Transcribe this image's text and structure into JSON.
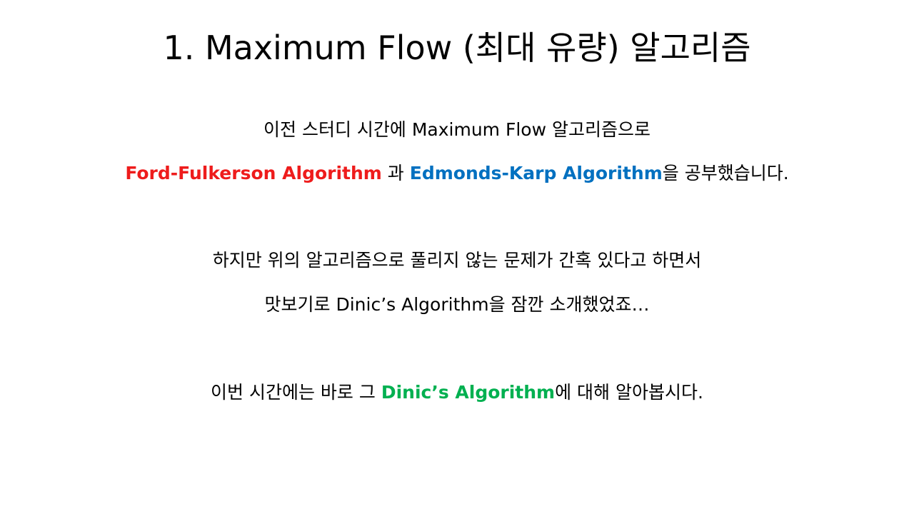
{
  "slide": {
    "title": "1. Maximum Flow (최대 유량) 알고리즘",
    "line1": "이전 스터디 시간에 Maximum Flow 알고리즘으로",
    "line2": {
      "ford_fulkerson": "Ford-Fulkerson Algorithm",
      "connector": " 과 ",
      "edmonds_karp": "Edmonds-Karp Algorithm",
      "suffix": "을 공부했습니다."
    },
    "line3": "하지만 위의 알고리즘으로 풀리지 않는 문제가 간혹 있다고 하면서",
    "line4": "맛보기로 Dinic’s Algorithm을 잠깐 소개했었죠…",
    "line5": {
      "prefix": "이번 시간에는 바로 그 ",
      "dinic": "Dinic’s Algorithm",
      "suffix": "에 대해 알아봅시다."
    }
  },
  "colors": {
    "ford_fulkerson": "#ee1c1c",
    "edmonds_karp": "#0070c0",
    "dinic": "#00b050",
    "text": "#000000",
    "background": "#ffffff"
  }
}
